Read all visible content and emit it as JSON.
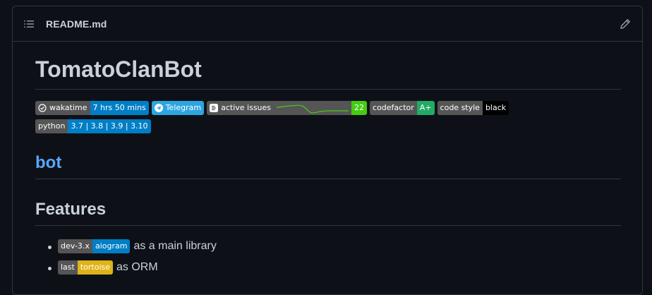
{
  "header": {
    "file_name": "README.md",
    "list_icon": "list-unordered-icon",
    "edit_icon": "pencil-icon"
  },
  "content": {
    "title": "TomatoClanBot",
    "badges_row1": {
      "wakatime": {
        "label": "wakatime",
        "value": "7 hrs 50 mins",
        "icon": "clock-icon"
      },
      "telegram": {
        "label": "Telegram",
        "icon": "telegram-icon"
      },
      "issues": {
        "label": "active issues",
        "value": "22",
        "icon": "deepsource-icon"
      },
      "codefactor": {
        "label": "codefactor",
        "value": "A+"
      },
      "codestyle": {
        "label": "code style",
        "value": "black"
      }
    },
    "badges_row2": {
      "python": {
        "label": "python",
        "value": "3.7 | 3.8 | 3.9 | 3.10"
      }
    },
    "bot_heading": "bot",
    "features_heading": "Features",
    "features": [
      {
        "badge_label": "dev-3.x",
        "badge_value": "aiogram",
        "text": "as a main library"
      },
      {
        "badge_label": "last",
        "badge_value": "tortoise",
        "text": "as ORM"
      }
    ]
  },
  "colors": {
    "background": "#0d1117",
    "border": "#30363d",
    "text": "#c9d1d9",
    "link": "#58a6ff",
    "badge_label_bg": "#555555",
    "badge_blue": "#007ec6",
    "badge_telegram": "#2ca5e0",
    "badge_green": "#4c1",
    "badge_codefactor": "#22aa66",
    "badge_black": "#000000",
    "badge_yellow": "#dfb317"
  }
}
